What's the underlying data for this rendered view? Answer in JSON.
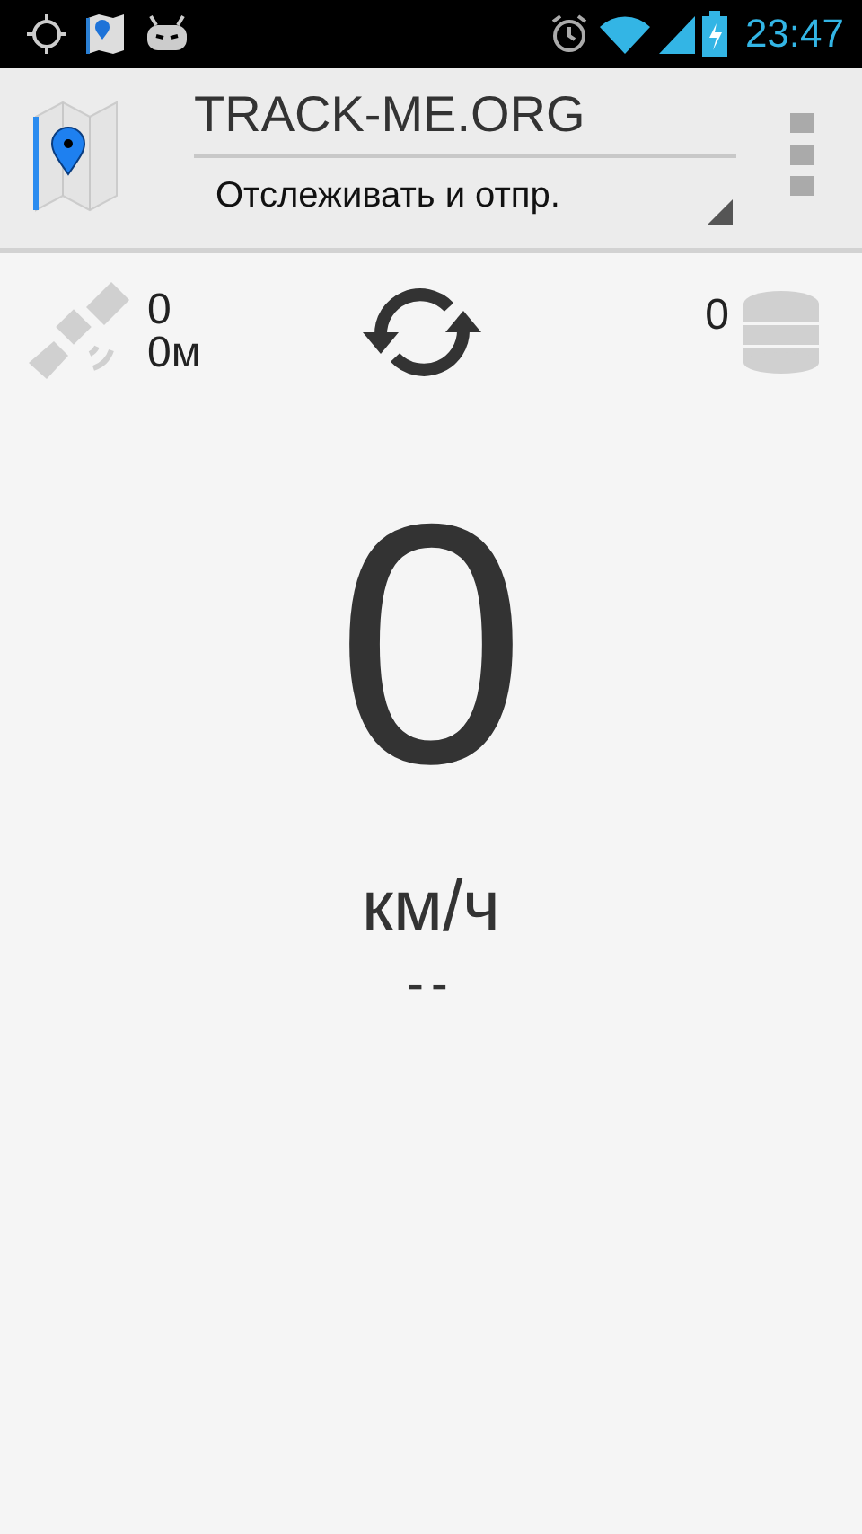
{
  "status_bar": {
    "time": "23:47"
  },
  "app_bar": {
    "title": "TRACK-ME.ORG",
    "mode": "Отслеживать и отпр."
  },
  "gps": {
    "satellites": "0",
    "accuracy": "0м"
  },
  "storage": {
    "count": "0"
  },
  "speed": {
    "value": "0",
    "unit": "км/ч",
    "extra": "--"
  }
}
